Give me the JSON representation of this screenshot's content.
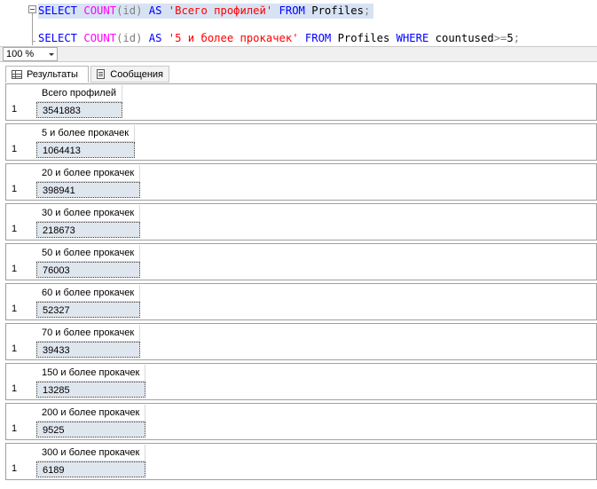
{
  "editor": {
    "lines": [
      {
        "tokens": [
          {
            "t": "SELECT",
            "c": "kw"
          },
          {
            "t": " ",
            "c": "pl"
          },
          {
            "t": "COUNT",
            "c": "fn"
          },
          {
            "t": "(id)",
            "c": "gr"
          },
          {
            "t": " ",
            "c": "pl"
          },
          {
            "t": "AS",
            "c": "kw"
          },
          {
            "t": " ",
            "c": "pl"
          },
          {
            "t": "'Всего профилей'",
            "c": "str"
          },
          {
            "t": " ",
            "c": "pl"
          },
          {
            "t": "FROM",
            "c": "kw"
          },
          {
            "t": " Profiles",
            "c": "pl"
          },
          {
            "t": ";",
            "c": "gr"
          }
        ]
      },
      {
        "tokens": [
          {
            "t": "SELECT",
            "c": "kw"
          },
          {
            "t": " ",
            "c": "pl"
          },
          {
            "t": "COUNT",
            "c": "fn"
          },
          {
            "t": "(id)",
            "c": "gr"
          },
          {
            "t": " ",
            "c": "pl"
          },
          {
            "t": "AS",
            "c": "kw"
          },
          {
            "t": " ",
            "c": "pl"
          },
          {
            "t": "'5 и более прокачек'",
            "c": "str"
          },
          {
            "t": " ",
            "c": "pl"
          },
          {
            "t": "FROM",
            "c": "kw"
          },
          {
            "t": " Profiles ",
            "c": "pl"
          },
          {
            "t": "WHERE",
            "c": "kw"
          },
          {
            "t": " countused",
            "c": "pl"
          },
          {
            "t": ">=",
            "c": "gr"
          },
          {
            "t": "5",
            "c": "pl"
          },
          {
            "t": ";",
            "c": "gr"
          }
        ]
      }
    ]
  },
  "zoom": {
    "value": "100 %"
  },
  "tabs": {
    "results": "Результаты",
    "messages": "Сообщения"
  },
  "results": [
    {
      "header": "Всего профилей",
      "row": "1",
      "value": "3541883"
    },
    {
      "header": "5 и более прокачек",
      "row": "1",
      "value": "1064413"
    },
    {
      "header": "20 и более прокачек",
      "row": "1",
      "value": "398941"
    },
    {
      "header": "30 и более прокачек",
      "row": "1",
      "value": "218673"
    },
    {
      "header": "50 и более прокачек",
      "row": "1",
      "value": "76003"
    },
    {
      "header": "60 и более прокачек",
      "row": "1",
      "value": "52327"
    },
    {
      "header": "70 и более прокачек",
      "row": "1",
      "value": "39433"
    },
    {
      "header": "150 и более прокачек",
      "row": "1",
      "value": "13285"
    },
    {
      "header": "200 и более прокачек",
      "row": "1",
      "value": "9525"
    },
    {
      "header": "300 и более прокачек",
      "row": "1",
      "value": "6189"
    }
  ]
}
